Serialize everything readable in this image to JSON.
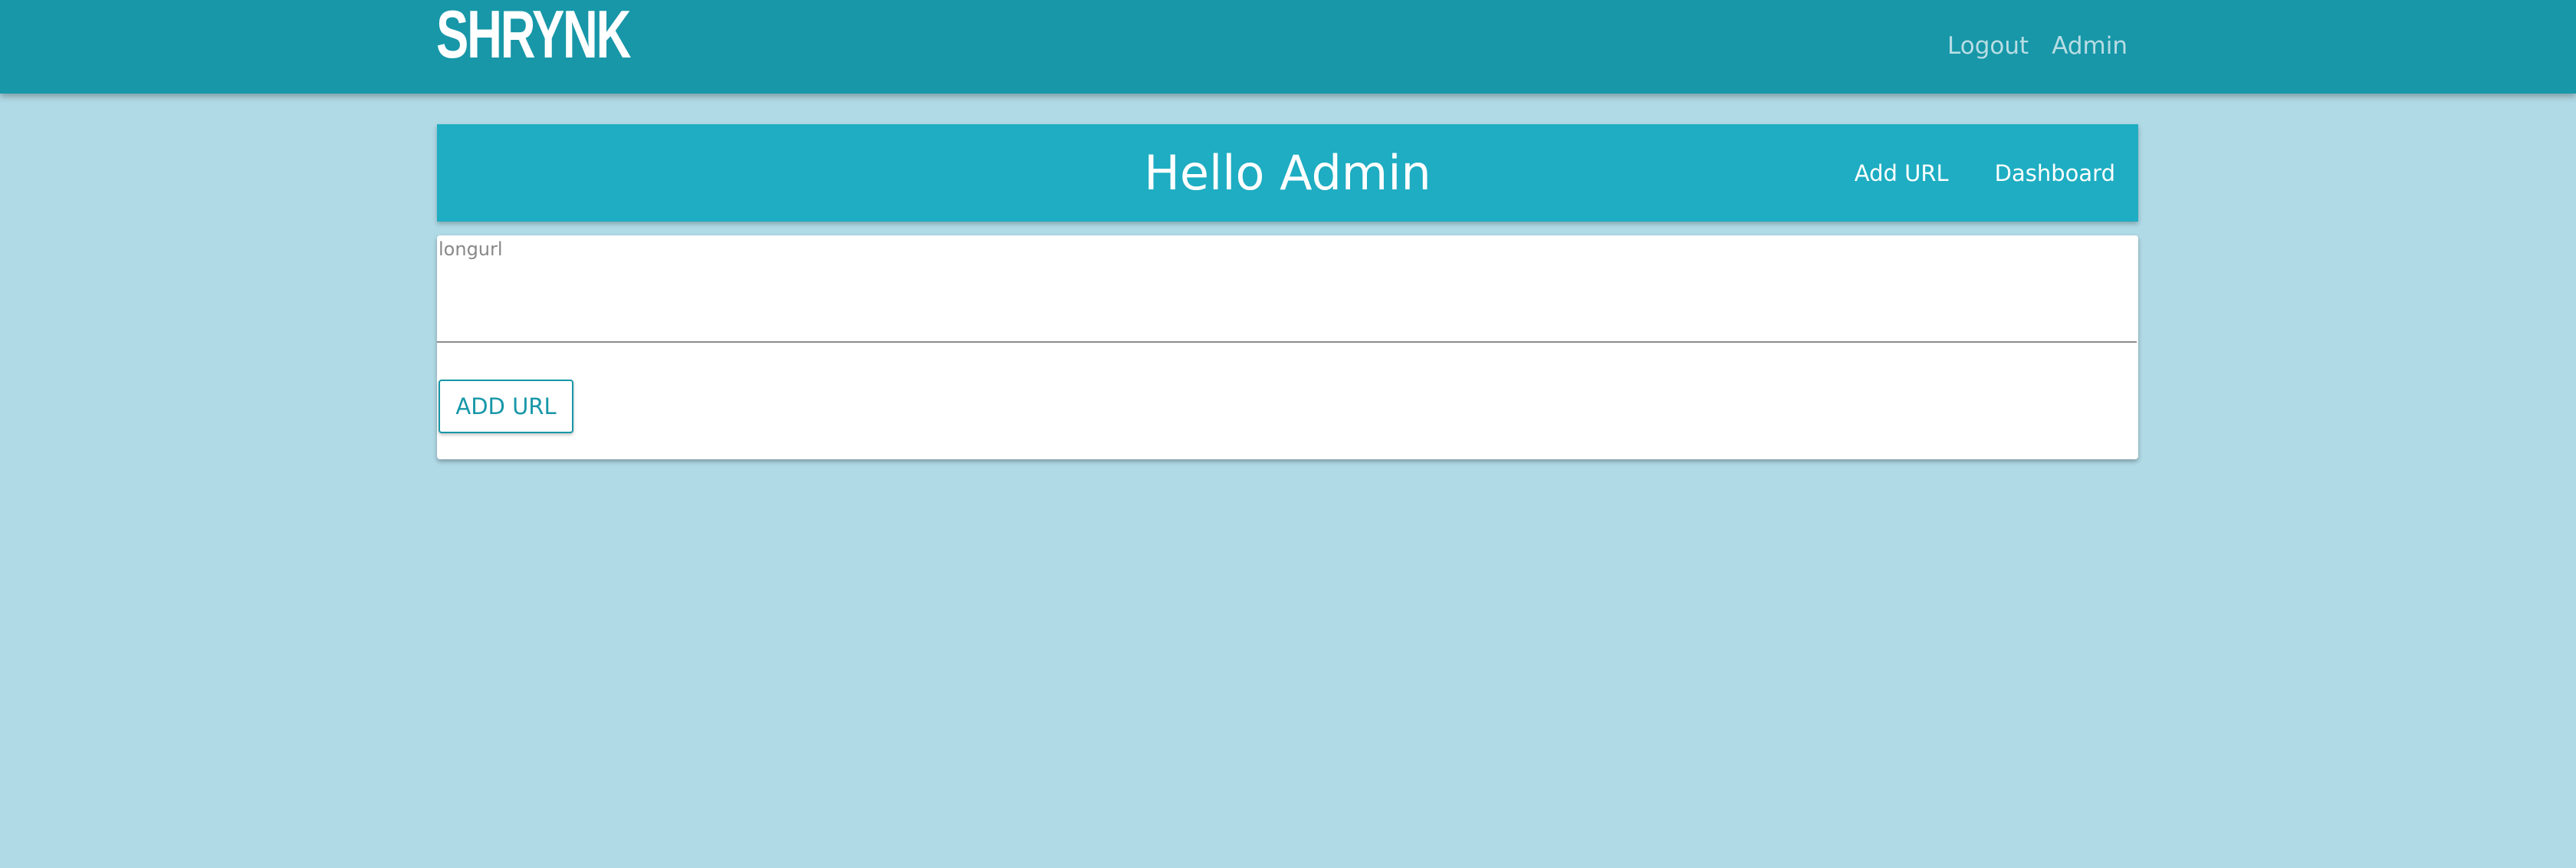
{
  "header": {
    "logo": "SHRYNK",
    "links": [
      "Logout",
      "Admin"
    ]
  },
  "hello_bar": {
    "title": "Hello Admin",
    "nav": [
      "Add URL",
      "Dashboard"
    ]
  },
  "form": {
    "textarea_placeholder": "longurl",
    "textarea_value": "",
    "submit_label": "ADD URL"
  },
  "colors": {
    "page_background": "#b0dae6",
    "topbar": "#1797a8",
    "hello_bar": "#1eadc2",
    "card": "#ffffff",
    "accent": "#1797a8"
  }
}
